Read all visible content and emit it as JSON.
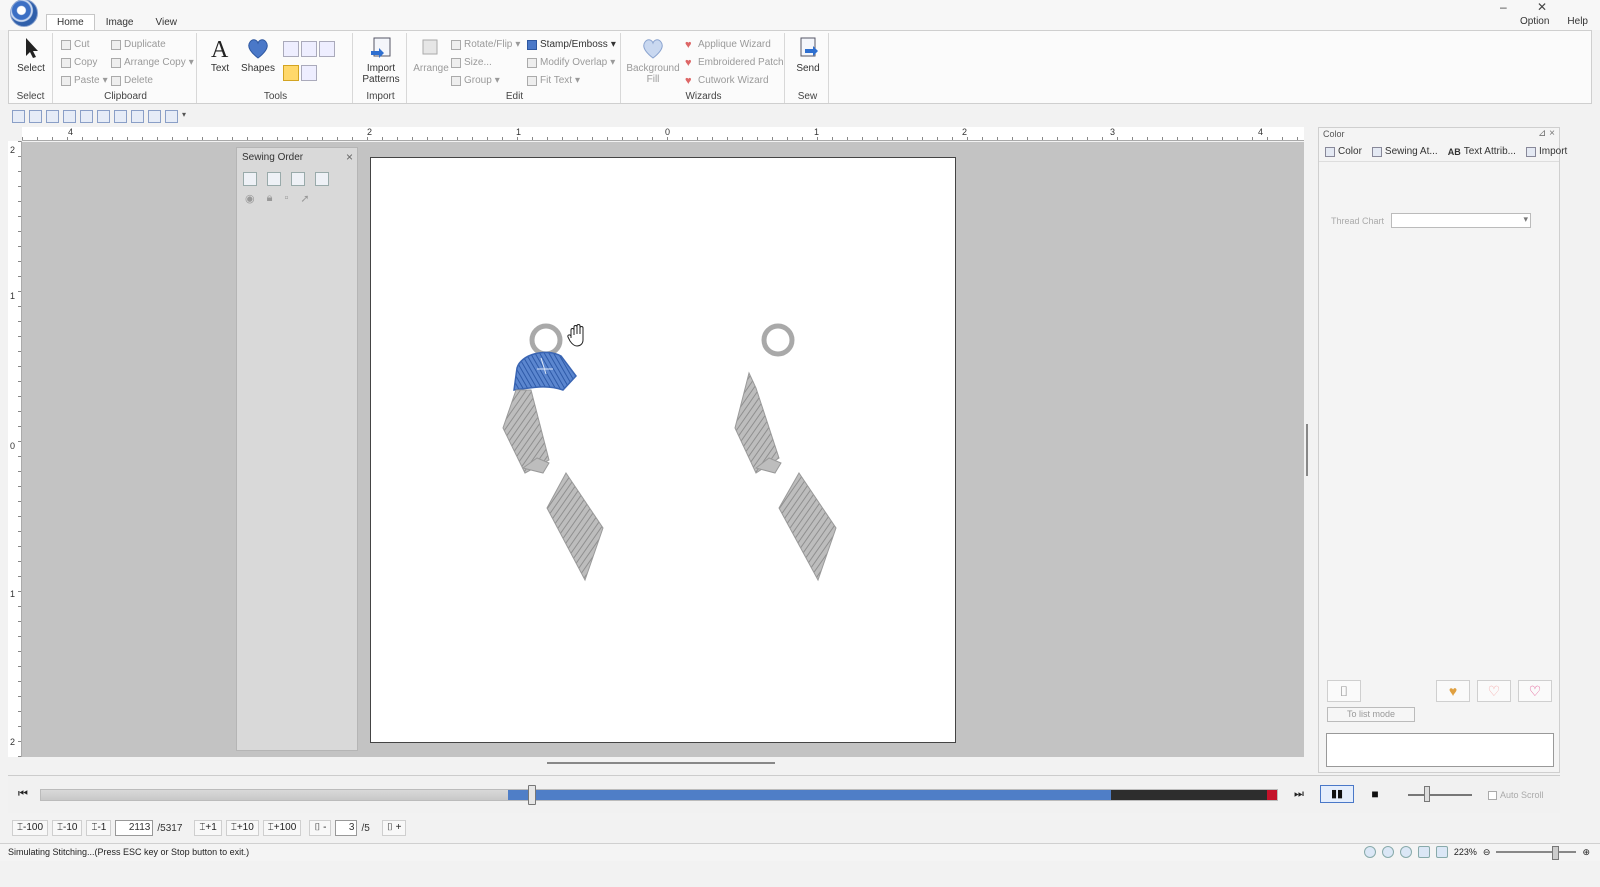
{
  "app": {
    "window_controls": [
      "‒",
      "✕"
    ]
  },
  "tabs": [
    "Home",
    "Image",
    "View"
  ],
  "menu_right": [
    "Option",
    "Help"
  ],
  "ribbon": {
    "select": {
      "label": "Select",
      "group": "Select"
    },
    "clipboard": {
      "group": "Clipboard",
      "cut": "Cut",
      "copy": "Copy",
      "paste": "Paste",
      "duplicate": "Duplicate",
      "arrange_copy": "Arrange Copy",
      "delete": "Delete"
    },
    "tools": {
      "group": "Tools",
      "text": "Text",
      "shapes": "Shapes"
    },
    "import": {
      "group": "Import",
      "import_patterns": "Import Patterns"
    },
    "edit": {
      "group": "Edit",
      "arrange": "Arrange",
      "rotate_flip": "Rotate/Flip",
      "size": "Size...",
      "group_btn": "Group",
      "stamp_emboss": "Stamp/Emboss",
      "modify_overlap": "Modify Overlap",
      "fit_text": "Fit Text"
    },
    "wizards": {
      "group": "Wizards",
      "background_fill": "Background Fill",
      "applique_wizard": "Applique Wizard",
      "embroidered_patch": "Embroidered Patch",
      "cutwork_wizard": "Cutwork Wizard"
    },
    "sew": {
      "group": "Sew",
      "send": "Send"
    }
  },
  "ruler": {
    "h_labels": [
      "4",
      "2",
      "1",
      "0",
      "1",
      "2",
      "3",
      "4"
    ],
    "v_labels": [
      "2",
      "1",
      "0",
      "1",
      "2"
    ]
  },
  "sewing_order": {
    "title": "Sewing Order"
  },
  "color_panel": {
    "title": "Color",
    "tabs": [
      "Color",
      "Sewing At...",
      "Text Attrib...",
      "Import"
    ],
    "thread_chart_label": "Thread Chart",
    "list_mode_label": "To list mode"
  },
  "playback": {
    "progress_current": 2113,
    "progress_total": 5317,
    "auto_scroll_label": "Auto Scroll",
    "colors": {
      "selected": "#4f7ec7",
      "remaining": "#2d2d2d",
      "end": "#c4122a"
    }
  },
  "stepbar": {
    "steps_back": [
      "-100",
      "-10",
      "-1"
    ],
    "stitch_current": "2113",
    "stitch_total": "/5317",
    "steps_fwd": [
      "+1",
      "+10",
      "+100"
    ],
    "color_minus": "-",
    "color_current": "3",
    "color_total": "/5",
    "color_plus": "+"
  },
  "status": {
    "message": "Simulating Stitching...(Press ESC key or Stop button to exit.)",
    "zoom": "223%"
  },
  "design": {
    "thread_color": "#4a78c8",
    "gray_color": "#a9a9a9"
  }
}
